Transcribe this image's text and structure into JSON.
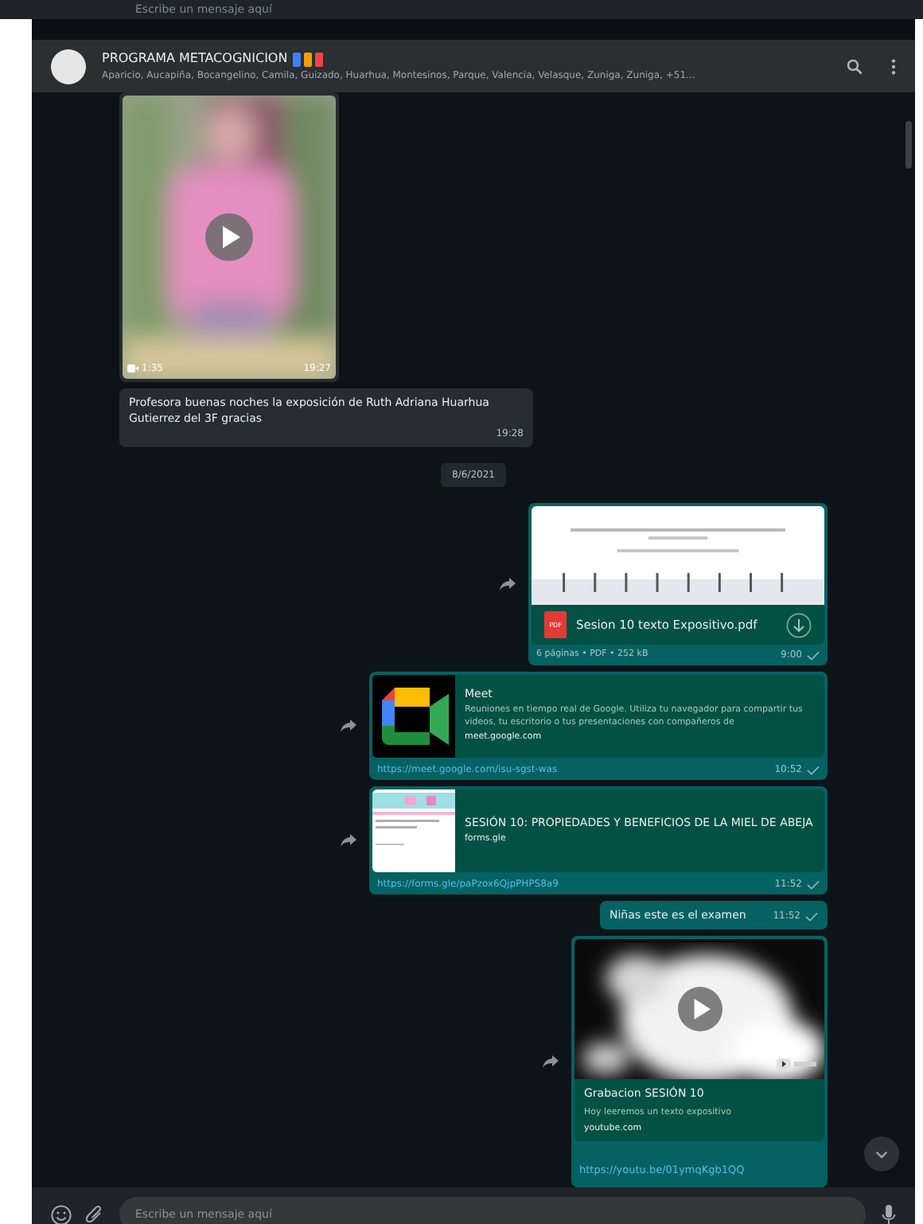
{
  "top_composer": {
    "placeholder": "Escribe un mensaje aquí"
  },
  "header": {
    "title": "PROGRAMA METACOGNICION",
    "title_marks": [
      {
        "color": "#3b82f6"
      },
      {
        "color": "#f59e0b"
      },
      {
        "color": "#ef4444"
      }
    ],
    "subtitle": "Aparicio, Aucapiña, Bocangelino, Camila, Guizado, Huarhua, Montesinos, Parque, Valencia, Velasque, Zuniga, Zuniga, +51…"
  },
  "messages": [
    {
      "kind": "video",
      "outgoing": false,
      "duration": "1:35",
      "time": "19:27"
    },
    {
      "kind": "text",
      "outgoing": false,
      "text": "Profesora buenas noches la exposición de Ruth Adriana Huarhua Gutierrez del 3F gracias",
      "time": "19:28"
    },
    {
      "kind": "date",
      "text": "8/6/2021"
    },
    {
      "kind": "document",
      "outgoing": true,
      "forwarded": true,
      "file": "Sesion 10 texto Expositivo.pdf",
      "badge": "PDF",
      "meta": "6 páginas • PDF • 252 kB",
      "time": "9:00"
    },
    {
      "kind": "call",
      "outgoing": true,
      "forwarded": true,
      "title": "Meet",
      "description": "Reuniones en tiempo real de Google. Utiliza tu navegador para compartir tus videos, tu escritorio o tus presentaciones con compañeros de",
      "domain": "meet.google.com",
      "url": "https://meet.google.com/isu-sgst-was",
      "time": "10:52"
    },
    {
      "kind": "form",
      "outgoing": true,
      "forwarded": true,
      "title": "SESIÓN 10: PROPIEDADES Y BENEFICIOS DE LA MIEL DE ABEJA",
      "domain": "forms.gle",
      "url": "https://forms.gle/paPzox6QjpPHPS8a9",
      "time": "11:52"
    },
    {
      "kind": "text",
      "outgoing": true,
      "text": "Niñas este es el examen",
      "time": "11:52"
    },
    {
      "kind": "youtube",
      "outgoing": true,
      "forwarded": true,
      "title": "Grabacion SESIÓN 10",
      "description": "Hoy leeremos un texto expositivo",
      "domain": "youtube.com",
      "url": "https://youtu.be/01ymqKgb1QQ"
    }
  ],
  "composer": {
    "placeholder": "Escribe un mensaje aquí"
  }
}
